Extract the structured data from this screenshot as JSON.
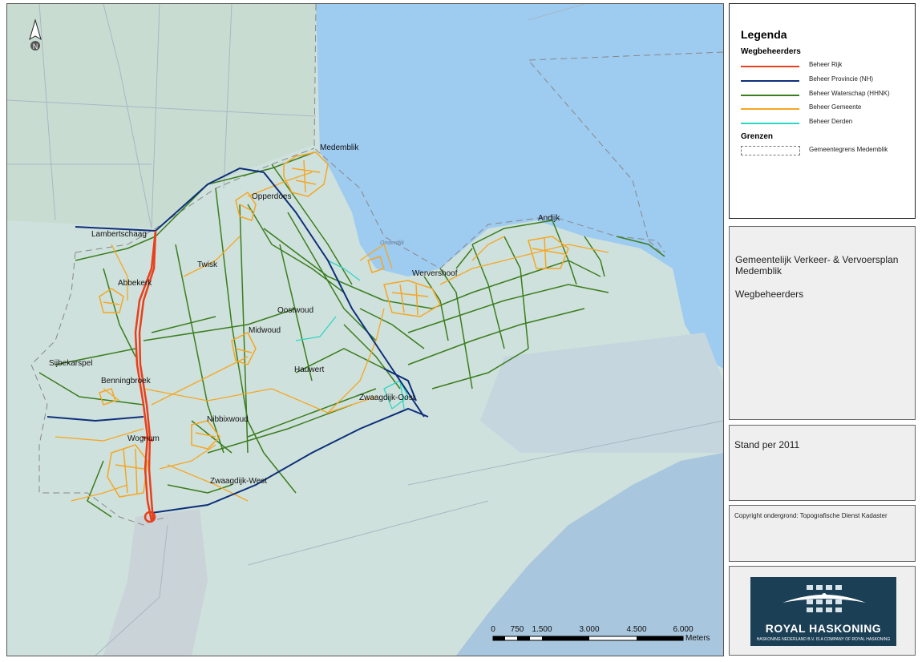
{
  "map": {
    "north_label": "N",
    "water_label": "Onderdijk",
    "places": [
      {
        "name": "Medemblik"
      },
      {
        "name": "Opperdoes"
      },
      {
        "name": "Lambertschaag"
      },
      {
        "name": "Twisk"
      },
      {
        "name": "Abbekerk"
      },
      {
        "name": "Oostwoud"
      },
      {
        "name": "Midwoud"
      },
      {
        "name": "Wervershoof"
      },
      {
        "name": "Andijk"
      },
      {
        "name": "Sijbekarspel"
      },
      {
        "name": "Benningbroek"
      },
      {
        "name": "Hauwert"
      },
      {
        "name": "Zwaagdijk-Oost"
      },
      {
        "name": "Nibbixwoud"
      },
      {
        "name": "Wognum"
      },
      {
        "name": "Zwaagdijk-West"
      }
    ],
    "scale": {
      "ticks": [
        "0",
        "750",
        "1.500",
        "3.000",
        "4.500",
        "6.000"
      ],
      "unit": "Meters"
    }
  },
  "legend": {
    "title": "Legenda",
    "section_roads": "Wegbeheerders",
    "items": [
      {
        "label": "Beheer Rijk",
        "color": "#e8401c"
      },
      {
        "label": "Beheer Provincie (NH)",
        "color": "#0d2f7a"
      },
      {
        "label": "Beheer Waterschap (HHNK)",
        "color": "#3a7d1e"
      },
      {
        "label": "Beheer Gemeente",
        "color": "#f5a623"
      },
      {
        "label": "Beheer Derden",
        "color": "#2fd6c4"
      }
    ],
    "section_borders": "Grenzen",
    "border_label": "Gemeentegrens Medemblik"
  },
  "info": {
    "title": "Gemeentelijk Verkeer- & Vervoersplan Medemblik",
    "subtitle": "Wegbeheerders",
    "date": "Stand per 2011",
    "copyright": "Copyright ondergrond: Topografische Dienst Kadaster"
  },
  "logo": {
    "name": "ROYAL HASKONING",
    "subtitle": "HASKONING NEDERLAND B.V. IS A COMPANY OF ROYAL HASKONING"
  }
}
